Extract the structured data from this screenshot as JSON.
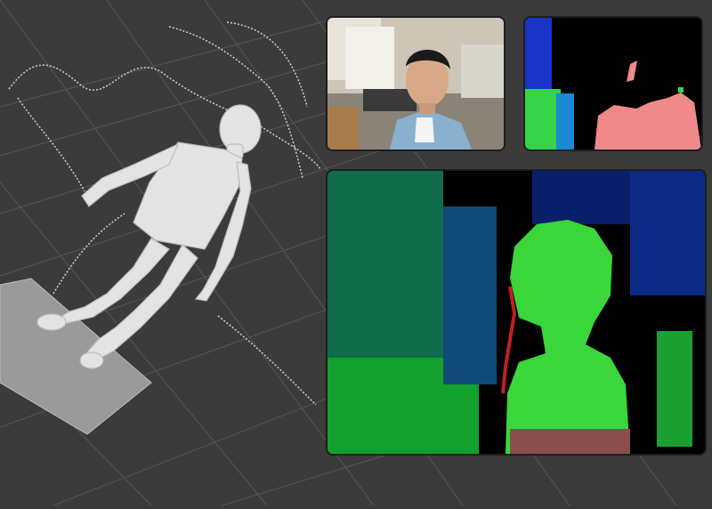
{
  "app": {
    "view": "3d-reconstruction",
    "background_color": "#3b3b3b"
  },
  "viewport": {
    "icons": [
      "grid-floor",
      "reconstructed-body-mesh",
      "camera-trajectory",
      "floor-plane"
    ],
    "mesh_color": "#e6e6e6",
    "grid_color": "#5a5a5a"
  },
  "panels": {
    "rgb": {
      "icon": "camera-feed",
      "frame_color": "#1e1e1e"
    },
    "segmentation": {
      "icon": "segmentation-mask",
      "colors": [
        "#1a35c8",
        "#35d44a",
        "#f08a8a",
        "#000000"
      ]
    },
    "depth": {
      "icon": "depth-overlay",
      "colors": [
        "#0c6a4c",
        "#2fd62f",
        "#8a3a3a",
        "#000000"
      ]
    }
  }
}
